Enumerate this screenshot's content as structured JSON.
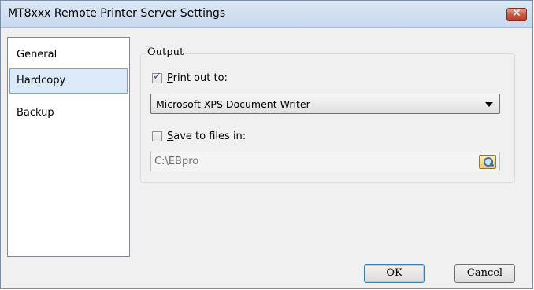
{
  "window": {
    "title": "MT8xxx Remote Printer Server Settings",
    "close_glyph": "✕"
  },
  "sidebar": {
    "items": [
      {
        "label": "General"
      },
      {
        "label": "Hardcopy",
        "selected": true
      },
      {
        "label": "Backup"
      }
    ]
  },
  "output": {
    "legend": "Output",
    "print_out": {
      "checked": true,
      "label_mnemonic": "P",
      "label_rest": "rint out to:",
      "printer_selected": "Microsoft XPS Document Writer"
    },
    "save_files": {
      "checked": false,
      "label_mnemonic": "S",
      "label_rest": "ave to files in:",
      "path": "C:\\EBpro",
      "browse_icon": "folder-browse-icon"
    }
  },
  "buttons": {
    "ok": "OK",
    "cancel": "Cancel"
  },
  "colors": {
    "selection_bg": "#dce9f8",
    "close_red": "#c75a45"
  }
}
